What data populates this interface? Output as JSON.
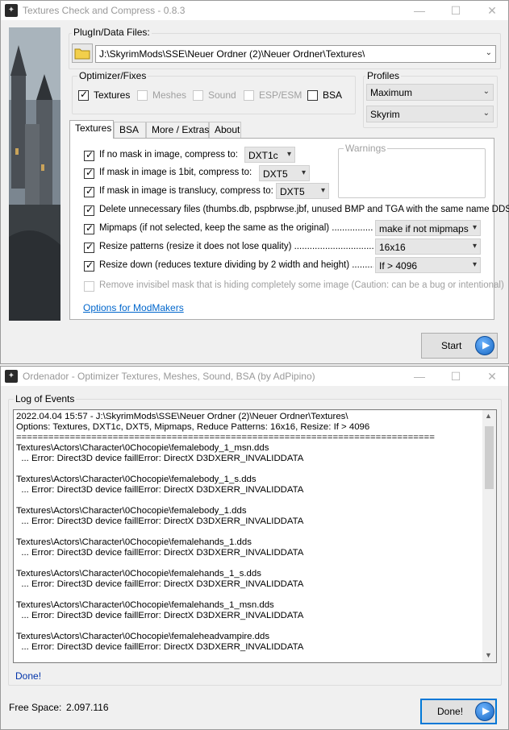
{
  "win1": {
    "title": "Textures Check and Compress - 0.8.3",
    "plugin_label": "PlugIn/Data Files:",
    "path": "J:\\SkyrimMods\\SSE\\Neuer Ordner (2)\\Neuer Ordner\\Textures\\",
    "optimizer_label": "Optimizer/Fixes",
    "opt_textures": "Textures",
    "opt_meshes": "Meshes",
    "opt_sound": "Sound",
    "opt_esp": "ESP/ESM",
    "opt_bsa": "BSA",
    "profiles_label": "Profiles",
    "profile_value": "Maximum",
    "game_value": "Skyrim",
    "tabs": [
      "Textures",
      "BSA",
      "More / Extras",
      "About"
    ],
    "warnings_label": "Warnings",
    "rows": [
      {
        "label": "If no mask in image, compress to:",
        "value": "DXT1c"
      },
      {
        "label": "If mask in image is 1bit, compress to:",
        "value": "DXT5"
      },
      {
        "label": "If mask in image is translucy, compress to:",
        "value": "DXT5"
      },
      {
        "label": "Delete unnecessary files (thumbs.db, pspbrwse.jbf, unused BMP and TGA with the same name DDS).",
        "value": ""
      },
      {
        "label": "Mipmaps (if not selected, keep the same as the original) ..........................",
        "value": "make if not mipmaps"
      },
      {
        "label": "Resize patterns (resize it does not lose quality) ..........................................",
        "value": "16x16"
      },
      {
        "label": "Resize down (reduces texture dividing by 2 width and height) .................",
        "value": "If > 4096"
      },
      {
        "label": "Remove invisibel mask that is hiding completely some image (Caution: can be a bug or intentional)",
        "value": ""
      }
    ],
    "modmakers_link": "Options for ModMakers",
    "start_label": "Start"
  },
  "win2": {
    "title": "Ordenador - Optimizer Textures, Meshes, Sound, BSA (by AdPipino)",
    "log_label": "Log of Events",
    "log_lines": [
      "2022.04.04 15:57 - J:\\SkyrimMods\\SSE\\Neuer Ordner (2)\\Neuer Ordner\\Textures\\",
      "Options: Textures, DXT1c, DXT5, Mipmaps, Reduce Patterns: 16x16, Resize: If > 4096",
      "==============================================================================",
      "Textures\\Actors\\Character\\0Chocopie\\femalebody_1_msn.dds",
      "  ... Error: Direct3D device faillError: DirectX D3DXERR_INVALIDDATA",
      "",
      "Textures\\Actors\\Character\\0Chocopie\\femalebody_1_s.dds",
      "  ... Error: Direct3D device faillError: DirectX D3DXERR_INVALIDDATA",
      "",
      "Textures\\Actors\\Character\\0Chocopie\\femalebody_1.dds",
      "  ... Error: Direct3D device faillError: DirectX D3DXERR_INVALIDDATA",
      "",
      "Textures\\Actors\\Character\\0Chocopie\\femalehands_1.dds",
      "  ... Error: Direct3D device faillError: DirectX D3DXERR_INVALIDDATA",
      "",
      "Textures\\Actors\\Character\\0Chocopie\\femalehands_1_s.dds",
      "  ... Error: Direct3D device faillError: DirectX D3DXERR_INVALIDDATA",
      "",
      "Textures\\Actors\\Character\\0Chocopie\\femalehands_1_msn.dds",
      "  ... Error: Direct3D device faillError: DirectX D3DXERR_INVALIDDATA",
      "",
      "Textures\\Actors\\Character\\0Chocopie\\femaleheadvampire.dds",
      "  ... Error: Direct3D device faillError: DirectX D3DXERR_INVALIDDATA"
    ],
    "done_text": "Done!",
    "free_space_label": "Free Space:",
    "free_space_value": "2.097.116",
    "done_button": "Done!"
  },
  "colors": {
    "accent": "#0078d7",
    "link": "#0066cc"
  }
}
